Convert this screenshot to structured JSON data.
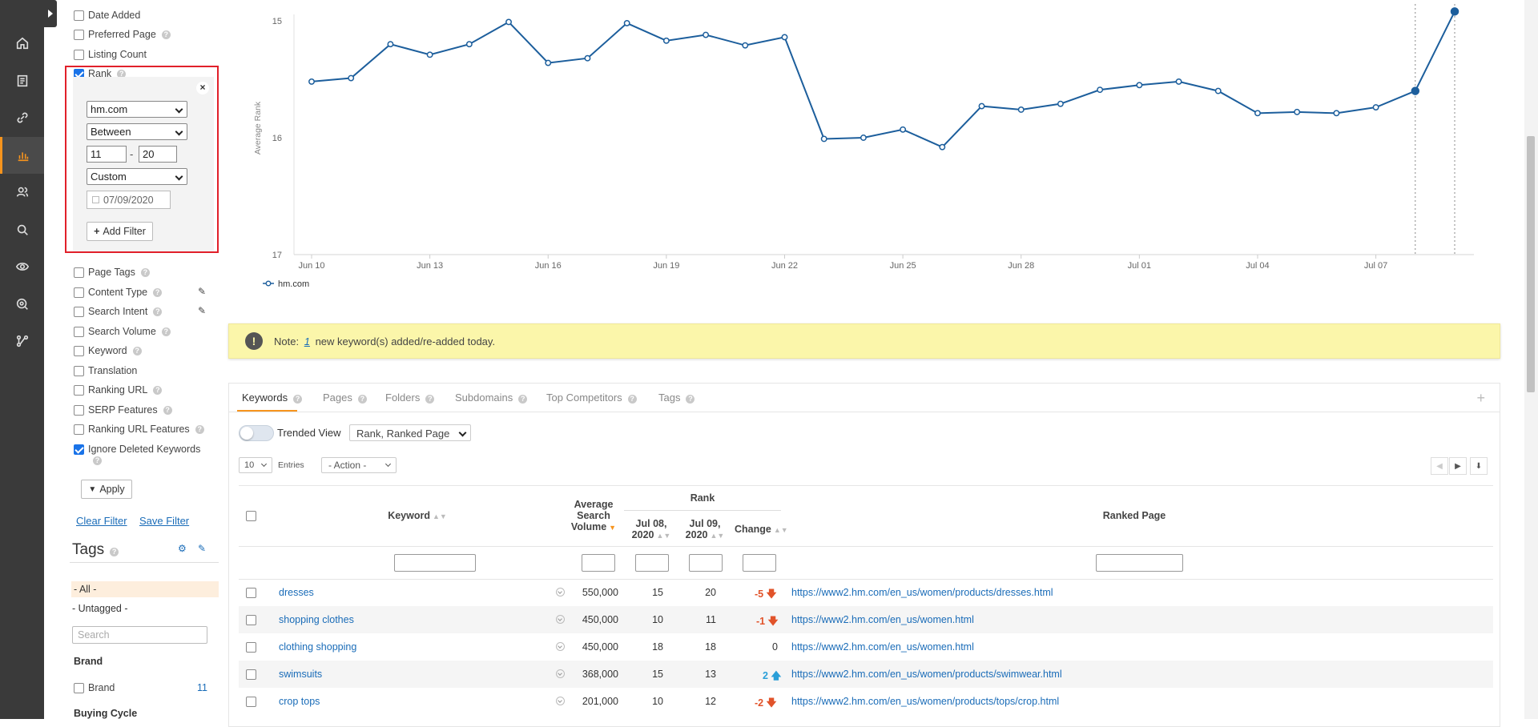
{
  "nav": {
    "items": [
      "home",
      "report",
      "link",
      "chart",
      "users",
      "search",
      "eye",
      "target",
      "network"
    ],
    "active_index": 3
  },
  "filters": {
    "items": [
      {
        "label": "Date Added",
        "checked": false
      },
      {
        "label": "Preferred Page",
        "checked": false,
        "help": true
      },
      {
        "label": "Listing Count",
        "checked": false
      },
      {
        "label": "Rank",
        "checked": true,
        "help": true
      }
    ],
    "rank": {
      "domain": "hm.com",
      "operator": "Between",
      "min": "11",
      "sep": "-",
      "max": "20",
      "period": "Custom",
      "date": "07/09/2020",
      "add_filter": "Add Filter",
      "close": "×"
    },
    "items2": [
      {
        "label": "Page Tags",
        "checked": false,
        "help": true
      },
      {
        "label": "Content Type",
        "checked": false,
        "help": true,
        "edit": true
      },
      {
        "label": "Search Intent",
        "checked": false,
        "help": true,
        "edit": true
      },
      {
        "label": "Search Volume",
        "checked": false,
        "help": true
      },
      {
        "label": "Keyword",
        "checked": false,
        "help": true
      },
      {
        "label": "Translation",
        "checked": false
      },
      {
        "label": "Ranking URL",
        "checked": false,
        "help": true
      },
      {
        "label": "SERP Features",
        "checked": false,
        "help": true
      },
      {
        "label": "Ranking URL Features",
        "checked": false,
        "help": true
      },
      {
        "label": "Ignore Deleted Keywords",
        "checked": true,
        "help": true
      }
    ],
    "apply": "Apply",
    "clear": "Clear Filter",
    "save": "Save Filter"
  },
  "tags": {
    "title": "Tags",
    "all": "- All -",
    "untagged": "- Untagged -",
    "search_placeholder": "Search",
    "groups": [
      {
        "name": "Brand",
        "items": [
          {
            "label": "Brand",
            "count": "11"
          }
        ]
      },
      {
        "name": "Buying Cycle",
        "items": []
      }
    ]
  },
  "chart_data": {
    "type": "line",
    "ylabel": "Average Rank",
    "y_ticks": [
      "15",
      "16",
      "17"
    ],
    "ylim": [
      17,
      15
    ],
    "y_inverted": true,
    "x_ticks": [
      "Jun 10",
      "Jun 13",
      "Jun 16",
      "Jun 19",
      "Jun 22",
      "Jun 25",
      "Jun 28",
      "Jul 01",
      "Jul 04",
      "Jul 07"
    ],
    "x": [
      "Jun 10",
      "Jun 11",
      "Jun 12",
      "Jun 13",
      "Jun 14",
      "Jun 15",
      "Jun 16",
      "Jun 17",
      "Jun 18",
      "Jun 19",
      "Jun 20",
      "Jun 21",
      "Jun 22",
      "Jun 23",
      "Jun 24",
      "Jun 25",
      "Jun 26",
      "Jun 27",
      "Jun 28",
      "Jun 29",
      "Jun 30",
      "Jul 01",
      "Jul 02",
      "Jul 03",
      "Jul 04",
      "Jul 05",
      "Jul 06",
      "Jul 07",
      "Jul 08",
      "Jul 09"
    ],
    "series": [
      {
        "name": "hm.com",
        "color": "#1c5e9c",
        "values": [
          15.52,
          15.49,
          15.2,
          15.29,
          15.2,
          15.01,
          15.36,
          15.32,
          15.02,
          15.17,
          15.12,
          15.21,
          15.14,
          16.01,
          16.0,
          15.93,
          16.08,
          15.73,
          15.76,
          15.71,
          15.59,
          15.55,
          15.52,
          15.6,
          15.79,
          15.78,
          15.79,
          15.74,
          15.6,
          14.92
        ]
      }
    ]
  },
  "note": {
    "prefix": "Note:",
    "count": "1",
    "suffix": "new keyword(s) added/re-added today."
  },
  "panel": {
    "tabs": [
      "Keywords",
      "Pages",
      "Folders",
      "Subdomains",
      "Top Competitors",
      "Tags"
    ],
    "active_tab": "Keywords",
    "trended_view": "Trended View",
    "column_select": "Rank, Ranked Page",
    "entries_value": "10",
    "entries_label": "Entries",
    "action": "- Action -"
  },
  "table": {
    "headers": {
      "keyword": "Keyword",
      "volume": "Average Search Volume",
      "rank_group": "Rank",
      "d1": "Jul 08, 2020",
      "d2": "Jul 09, 2020",
      "change": "Change",
      "ranked_page": "Ranked Page"
    },
    "rows": [
      {
        "keyword": "dresses",
        "volume": "550,000",
        "d1": "15",
        "d2": "20",
        "change": "-5",
        "dir": "down",
        "url": "https://www2.hm.com/en_us/women/products/dresses.html"
      },
      {
        "keyword": "shopping clothes",
        "volume": "450,000",
        "d1": "10",
        "d2": "11",
        "change": "-1",
        "dir": "down",
        "url": "https://www2.hm.com/en_us/women.html"
      },
      {
        "keyword": "clothing shopping",
        "volume": "450,000",
        "d1": "18",
        "d2": "18",
        "change": "0",
        "dir": "none",
        "url": "https://www2.hm.com/en_us/women.html"
      },
      {
        "keyword": "swimsuits",
        "volume": "368,000",
        "d1": "15",
        "d2": "13",
        "change": "2",
        "dir": "up",
        "url": "https://www2.hm.com/en_us/women/products/swimwear.html"
      },
      {
        "keyword": "crop tops",
        "volume": "201,000",
        "d1": "10",
        "d2": "12",
        "change": "-2",
        "dir": "down",
        "url": "https://www2.hm.com/en_us/women/products/tops/crop.html"
      }
    ]
  }
}
